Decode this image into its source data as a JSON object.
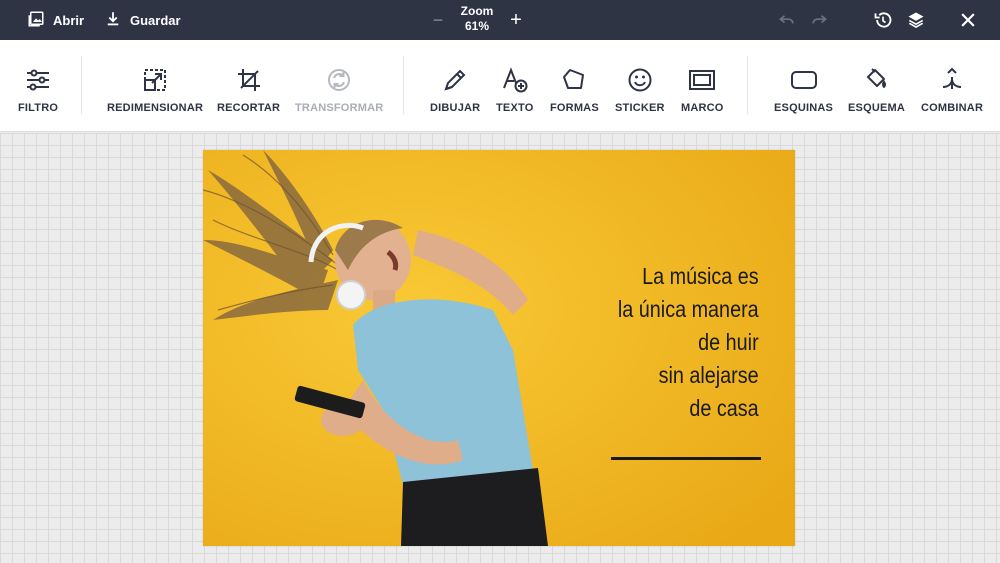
{
  "topbar": {
    "open_label": "Abrir",
    "save_label": "Guardar",
    "zoom_label": "Zoom",
    "zoom_value": "61%",
    "zoom_minus": "−",
    "zoom_plus": "+"
  },
  "toolbar": {
    "tools": [
      {
        "id": "filter",
        "label": "FILTRO",
        "icon": "sliders-icon"
      },
      {
        "id": "resize",
        "label": "REDIMENSIONAR",
        "icon": "resize-icon"
      },
      {
        "id": "crop",
        "label": "RECORTAR",
        "icon": "crop-icon"
      },
      {
        "id": "transform",
        "label": "TRANSFORMAR",
        "icon": "rotate-icon",
        "disabled": true
      },
      {
        "id": "draw",
        "label": "DIBUJAR",
        "icon": "pencil-icon"
      },
      {
        "id": "text",
        "label": "TEXTO",
        "icon": "text-add-icon"
      },
      {
        "id": "shapes",
        "label": "FORMAS",
        "icon": "pentagon-icon"
      },
      {
        "id": "sticker",
        "label": "STICKER",
        "icon": "smiley-icon"
      },
      {
        "id": "frame",
        "label": "MARCO",
        "icon": "frame-icon"
      },
      {
        "id": "corners",
        "label": "ESQUINAS",
        "icon": "rounded-rect-icon"
      },
      {
        "id": "scheme",
        "label": "ESQUEMA",
        "icon": "paint-bucket-icon"
      },
      {
        "id": "merge",
        "label": "COMBINAR",
        "icon": "merge-icon"
      }
    ]
  },
  "canvas": {
    "quote_lines": [
      "La música es",
      "la única manera",
      "de huir",
      "sin alejarse",
      "de casa"
    ]
  },
  "colors": {
    "topbar_bg": "#2e3444",
    "photo_bg": "#f3b823",
    "accent_text": "#2e3444",
    "disabled_text": "#a9adb5"
  }
}
